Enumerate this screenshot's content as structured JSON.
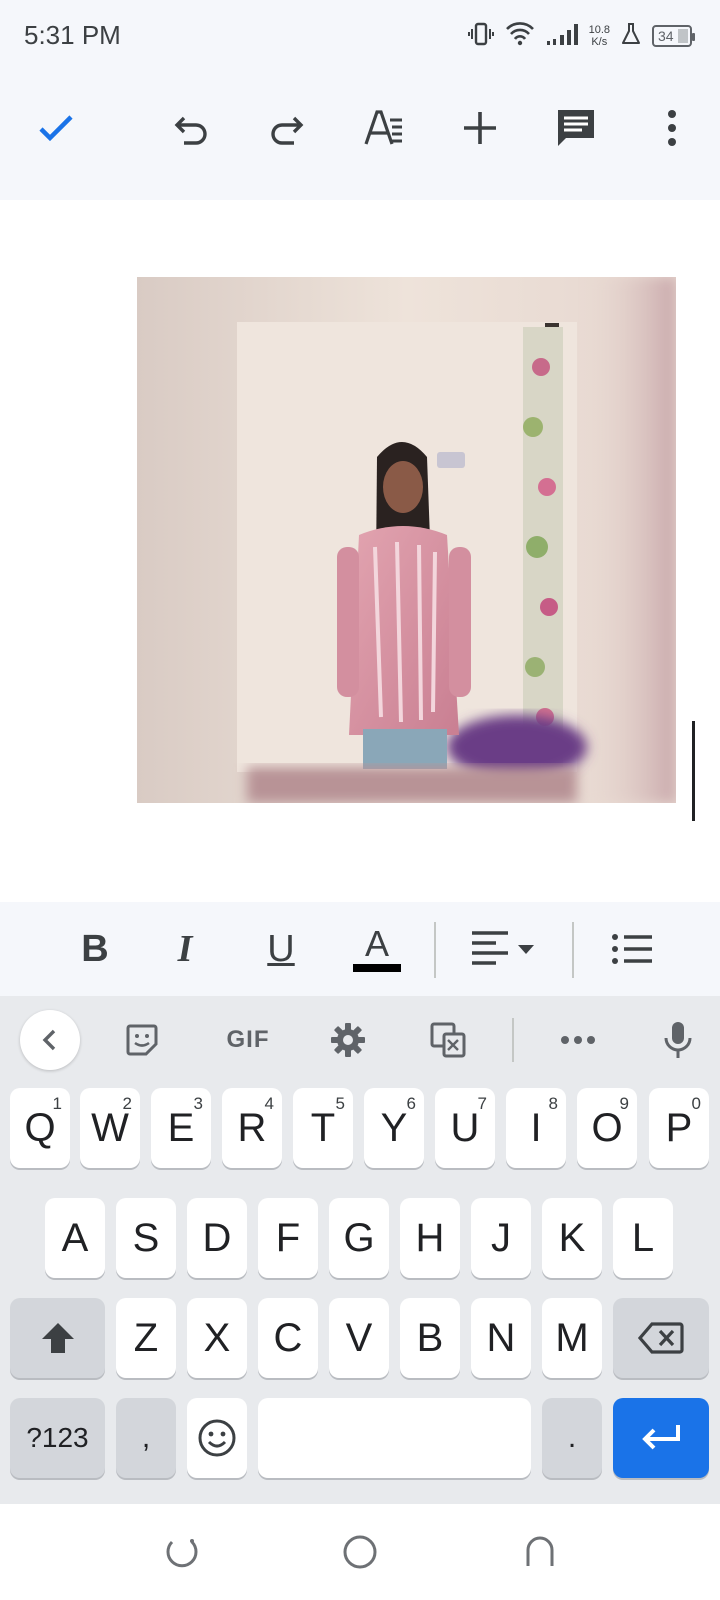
{
  "status_bar": {
    "time": "5:31 PM",
    "net_speed_value": "10.8",
    "net_speed_unit": "K/s",
    "battery": "34"
  },
  "toolbar": {
    "icons": [
      "check-icon",
      "undo-icon",
      "redo-icon",
      "text-format-icon",
      "insert-icon",
      "comment-icon",
      "more-icon"
    ],
    "accent_color": "#1a73e8"
  },
  "format_bar": {
    "bold": "B",
    "italic": "I",
    "underline": "U",
    "text_color": "A"
  },
  "keyboard": {
    "toolbar_gif": "GIF",
    "row1": [
      {
        "key": "Q",
        "hint": "1"
      },
      {
        "key": "W",
        "hint": "2"
      },
      {
        "key": "E",
        "hint": "3"
      },
      {
        "key": "R",
        "hint": "4"
      },
      {
        "key": "T",
        "hint": "5"
      },
      {
        "key": "Y",
        "hint": "6"
      },
      {
        "key": "U",
        "hint": "7"
      },
      {
        "key": "I",
        "hint": "8"
      },
      {
        "key": "O",
        "hint": "9"
      },
      {
        "key": "P",
        "hint": "0"
      }
    ],
    "row2": [
      "A",
      "S",
      "D",
      "F",
      "G",
      "H",
      "J",
      "K",
      "L"
    ],
    "row3": [
      "Z",
      "X",
      "C",
      "V",
      "B",
      "N",
      "M"
    ],
    "symbols_label": "?123",
    "comma": ",",
    "period": ".",
    "enter_color": "#1a73e8"
  }
}
